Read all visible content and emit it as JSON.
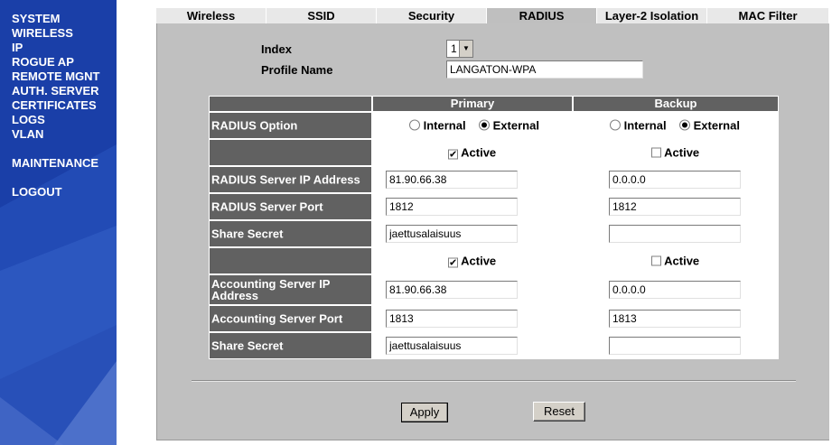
{
  "sidebar": {
    "items": [
      {
        "label": "SYSTEM"
      },
      {
        "label": "WIRELESS"
      },
      {
        "label": "IP"
      },
      {
        "label": "ROGUE AP"
      },
      {
        "label": "REMOTE MGNT"
      },
      {
        "label": "AUTH. SERVER"
      },
      {
        "label": "CERTIFICATES"
      },
      {
        "label": "LOGS"
      },
      {
        "label": "VLAN"
      }
    ],
    "maintenance": "MAINTENANCE",
    "logout": "LOGOUT"
  },
  "tabs": [
    "Wireless",
    "SSID",
    "Security",
    "RADIUS",
    "Layer-2 Isolation",
    "MAC Filter"
  ],
  "active_tab": "RADIUS",
  "form": {
    "index_label": "Index",
    "index_value": "1",
    "profile_label": "Profile Name",
    "profile_value": "LANGATON-WPA"
  },
  "table": {
    "col_primary": "Primary",
    "col_backup": "Backup",
    "radius_option_label": "RADIUS Option",
    "internal_label": "Internal",
    "external_label": "External",
    "active_label": "Active",
    "radius_ip_label": "RADIUS Server IP Address",
    "radius_port_label": "RADIUS Server Port",
    "share_secret_label": "Share Secret",
    "acct_ip_label": "Accounting Server IP Address",
    "acct_port_label": "Accounting Server Port",
    "primary": {
      "radius_active": true,
      "radius_ip": "81.90.66.38",
      "radius_port": "1812",
      "radius_secret": "jaettusalaisuus",
      "acct_active": true,
      "acct_ip": "81.90.66.38",
      "acct_port": "1813",
      "acct_secret": "jaettusalaisuus"
    },
    "backup": {
      "radius_active": false,
      "radius_ip": "0.0.0.0",
      "radius_port": "1812",
      "radius_secret": "",
      "acct_active": false,
      "acct_ip": "0.0.0.0",
      "acct_port": "1813",
      "acct_secret": ""
    }
  },
  "buttons": {
    "apply": "Apply",
    "reset": "Reset"
  },
  "colors": {
    "sidebar_bg": "#1a3fa8",
    "panel_bg": "#c0c0c0",
    "label_cell_bg": "#616161",
    "active_tab_bg": "#bfbfbf"
  }
}
